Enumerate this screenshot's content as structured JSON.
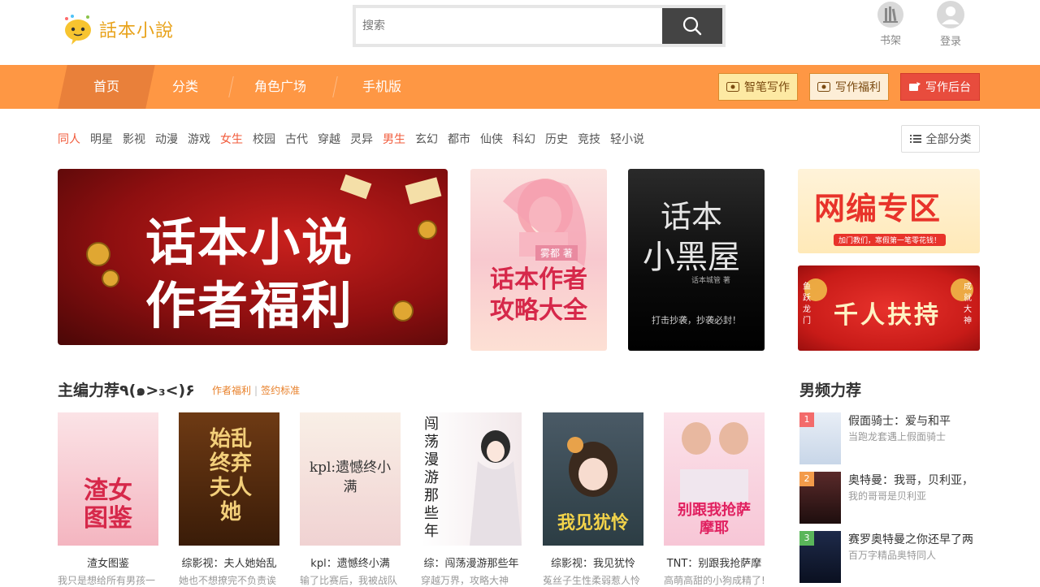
{
  "header": {
    "logo_text": "話本小說",
    "search_placeholder": "搜索",
    "shelf_label": "书架",
    "login_label": "登录"
  },
  "nav": {
    "items": [
      "首页",
      "分类",
      "角色广场",
      "手机版"
    ],
    "buttons": [
      "智笔写作",
      "写作福利",
      "写作后台"
    ],
    "colors": {
      "bar": "#fe9744",
      "active": "#e9803a",
      "yellow_btn": "#fde9a3",
      "red_btn": "#e84c3d"
    }
  },
  "categories": [
    "同人",
    "明星",
    "影视",
    "动漫",
    "游戏",
    "女生",
    "校园",
    "古代",
    "穿越",
    "灵异",
    "男生",
    "玄幻",
    "都市",
    "仙侠",
    "科幻",
    "历史",
    "竞技",
    "轻小说"
  ],
  "all_categories_label": "全部分类",
  "banners": {
    "main": {
      "line1": "话本小说",
      "line2": "作者福利"
    },
    "guide": {
      "author": "雾都 著",
      "title": "话本作者攻略大全"
    },
    "blackroom": {
      "title1": "话本",
      "title2": "小黑屋",
      "author": "话本城管 著",
      "slogan": "打击抄袭，抄袭必封！"
    },
    "web": {
      "title": "网编专区",
      "sub": "加门教们，寒假第一笔零花钱！"
    },
    "thousand": {
      "title": "千人扶持",
      "left": "鱼跃龙门",
      "right": "成就大神"
    }
  },
  "recommend": {
    "title": "主编力荐٩(๑>₃<)۶",
    "link1": "作者福利",
    "link2": "签约标准",
    "books": [
      {
        "cover_text": "渣女图鉴",
        "title": "渣女图鉴",
        "desc": "我只是想给所有男孩一"
      },
      {
        "cover_text": "始乱终弃夫人她",
        "title": "综影视：夫人她始乱",
        "desc": "她也不想撩完不负责诶"
      },
      {
        "cover_text": "kpl:遗憾终小满",
        "title": "kpl：遗憾终小满",
        "desc": "输了比赛后，我被战队"
      },
      {
        "cover_text": "闯荡漫游那些年",
        "title": "综：闯荡漫游那些年",
        "desc": "穿越万界，攻略大神"
      },
      {
        "cover_text": "我见犹怜",
        "title": "综影视：我见犹怜",
        "desc": "菟丝子生性柔弱惹人怜"
      },
      {
        "cover_text": "别跟我抢萨摩耶",
        "title": "TNT：别跟我抢萨摩",
        "desc": "高萌高甜的小狗成精了!"
      }
    ]
  },
  "male_recommend": {
    "title": "男频力荐",
    "items": [
      {
        "num": "1",
        "title": "假面骑士：爱与和平",
        "desc": "当跑龙套遇上假面骑士"
      },
      {
        "num": "2",
        "title": "奥特曼：我哥，贝利亚，",
        "desc": "我的哥哥是贝利亚"
      },
      {
        "num": "3",
        "title": "赛罗奥特曼之你还早了两",
        "desc": "百万字精品奥特同人"
      }
    ]
  }
}
